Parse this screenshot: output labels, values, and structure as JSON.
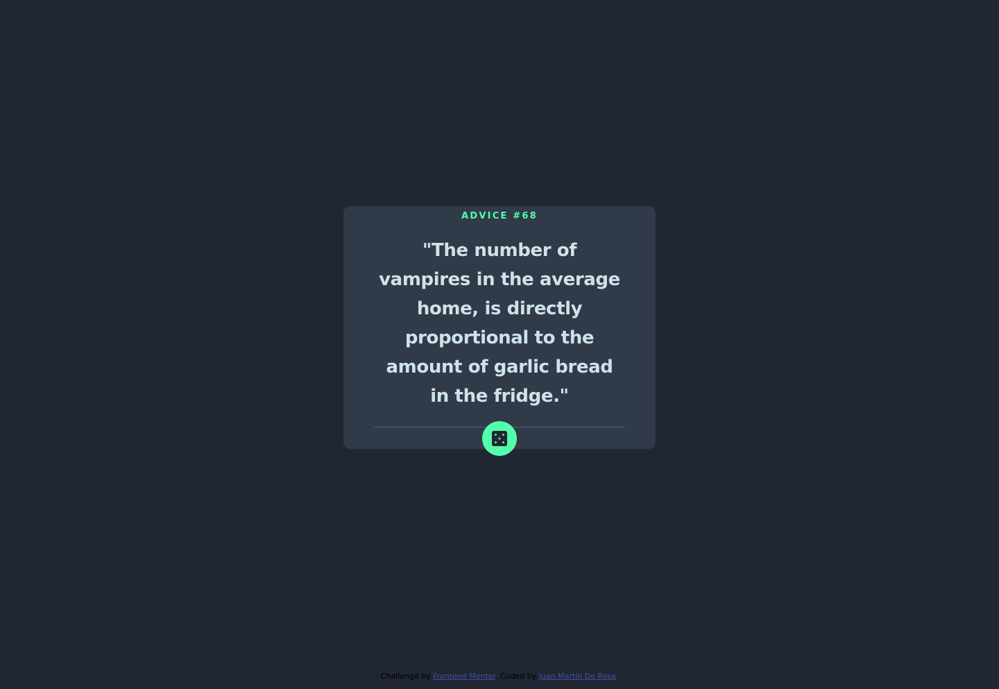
{
  "card": {
    "advice_label": "ADVICE #68",
    "quote": "\"The number of vampires in the average home, is directly proportional to the amount of garlic bread in the fridge.\""
  },
  "dice_button": {
    "icon": "dice-icon"
  },
  "attribution": {
    "challenge_prefix": "Challenge by",
    "challenge_link": "Frontend Mentor",
    "coded_prefix": ". Coded by",
    "coder_link": "Juan Martín De Rosa",
    "suffix": "."
  },
  "colors": {
    "background": "#202632",
    "card": "#313a48",
    "accent": "#53ffaa",
    "quote_text": "#cee3e9",
    "divider": "#4f5d74",
    "link": "#3e52a3"
  }
}
